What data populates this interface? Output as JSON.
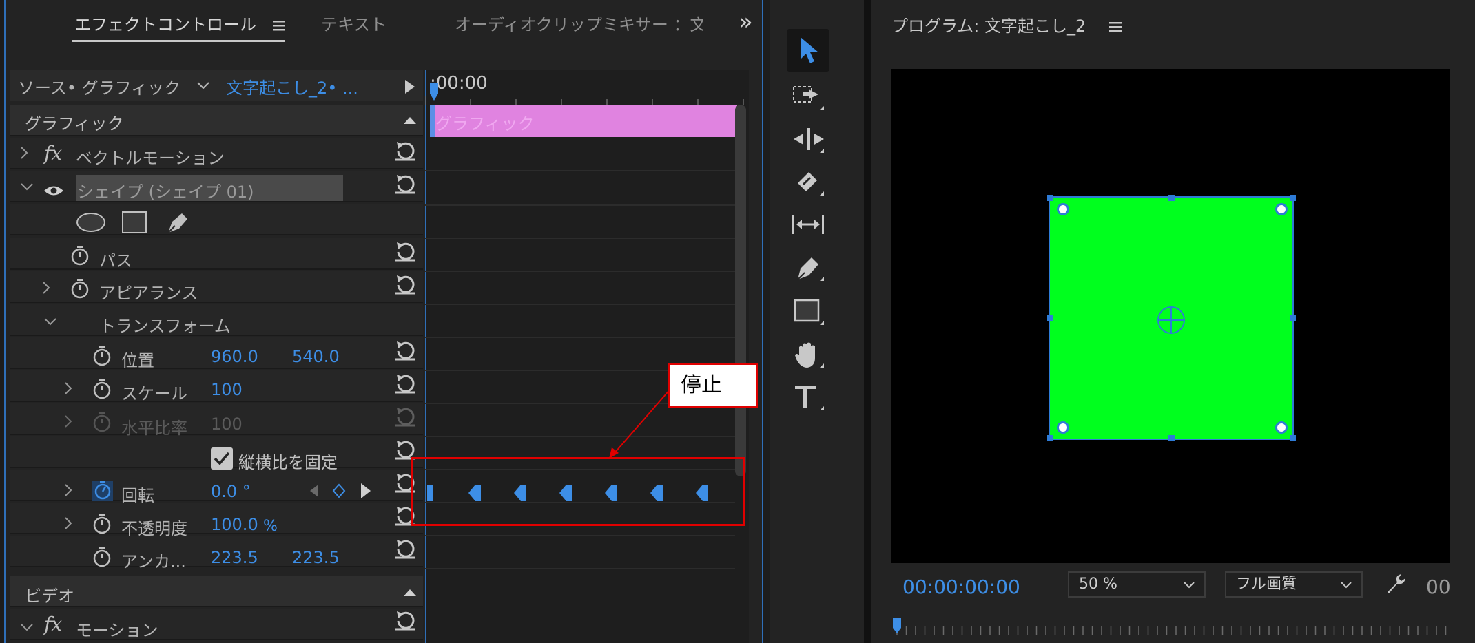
{
  "effect_controls": {
    "tabs": [
      {
        "label": "エフェクトコントロール"
      },
      {
        "label": "テキスト"
      },
      {
        "label": "オーディオクリップミキサー ：文"
      }
    ],
    "overflow_glyph": "»",
    "source_label": "ソース• グラフィック",
    "clip_name": "文字起こし_2• ...",
    "timecode_header": ":00:00",
    "clip_bar_label": "グラフィック",
    "rows": {
      "graphic_section": "グラフィック",
      "vector_motion": "ベクトルモーション",
      "shape_layer": "シェイプ (シェイプ 01)",
      "path": "パス",
      "appearance": "アピアランス",
      "transform": "トランスフォーム",
      "position": {
        "label": "位置",
        "x": "960.0",
        "y": "540.0"
      },
      "scale": {
        "label": "スケール",
        "value": "100"
      },
      "scale_width": {
        "label": "水平比率",
        "value": "100"
      },
      "uniform_scale": "縦横比を固定",
      "rotation": {
        "label": "回転",
        "value": "0.0 °"
      },
      "opacity": {
        "label": "不透明度",
        "value": "100.0",
        "unit": "%"
      },
      "anchor": {
        "label": "アンカ...",
        "x": "223.5",
        "y": "223.5"
      },
      "video_section": "ビデオ",
      "motion": "モーション"
    },
    "fx_label": "fx"
  },
  "annotation": {
    "callout_text": "停止",
    "color": "#e00000"
  },
  "program_monitor": {
    "title": "プログラム: 文字起こし_2",
    "timecode": "00:00:00:00",
    "zoom": "50 %",
    "quality": "フル画質",
    "trailing_timecode": "00",
    "shape_color": "#00ff1e"
  },
  "colors": {
    "accent": "#3d8ee6",
    "clip_bar": "#e083e0"
  }
}
